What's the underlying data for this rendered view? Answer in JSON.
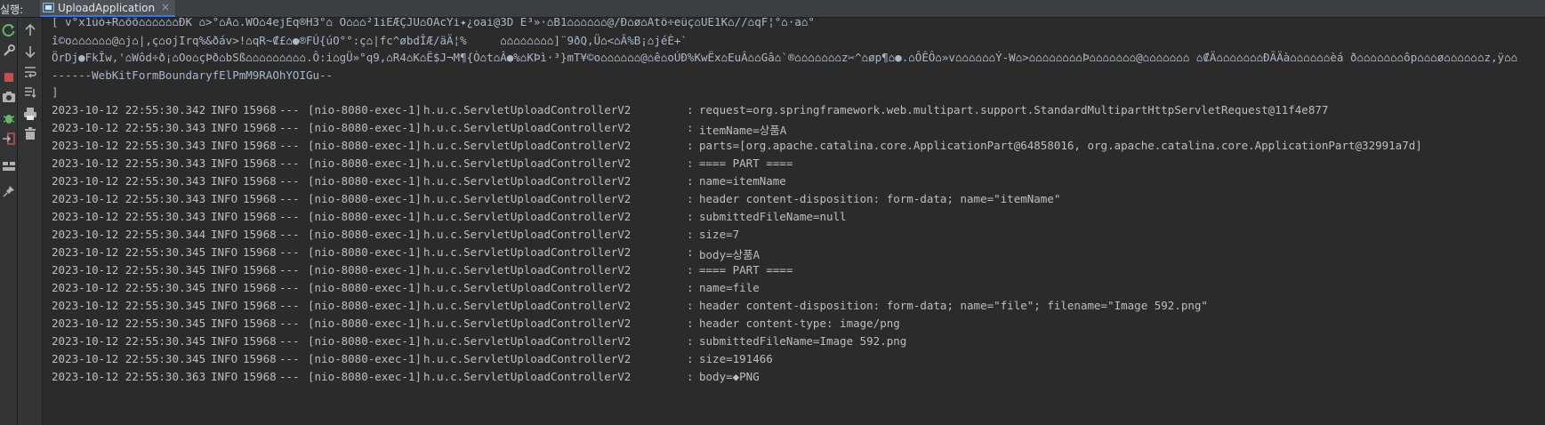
{
  "header": {
    "run_label": "실행:",
    "tab_title": "UploadApplication",
    "tab_close": "×"
  },
  "icons": {
    "left": [
      "rerun-icon",
      "settings-wrench-icon",
      "stop-icon",
      "camera-icon",
      "debug-icon",
      "login-icon",
      "layout-icon",
      "pin-icon"
    ],
    "right": [
      "up-arrow-icon",
      "down-arrow-icon",
      "soft-wrap-icon",
      "scroll-to-end-icon",
      "print-icon",
      "trash-icon"
    ]
  },
  "colors": {
    "accent": "#3574f0",
    "stop": "#c94f4f",
    "rerun": "#5fb865",
    "console_bg": "#2b2b2b",
    "log_text": "#bcbec4"
  },
  "console": {
    "garbled_lines": [
      "[ v°x1ûó+R⌂õõ⌂⌂⌂⌂⌂⌂ÐK ⌂>°⌂A⌂.WO⌂4ejEq®H3°⌂ O⌂⌂⌂²1iEÆÇJÜ⌂OAcYi✦¿oai@3D E³»·⌂B1⌂⌂⌂⌂⌂⌂@/Ð⌂ø⌂Atö÷eüç⌂UE1K⌂//⌂qF¦°⌂·a⌂°",
      "î©o⌂⌂⌂⌂⌂⌂@⌂j⌂|,ç⌂ojIrq%&ðáv>!⌂qR~₡£⌂●®FÚ{úO°°:ç⌂|fc^øbdÎÆ/äÄ¦%     ⌂⌂⌂⌂⌂⌂⌂⌂]¨9ðQ,Ü⌂<⌂Ã%B¡⌂jéÈ+`",
      "ÖrDj●FkÎw,'⌂Wôd÷ð¡⌂Oo⌂çÞð⌂bSß⌂⌂⌂⌂⌂⌂⌂⌂⌂.Ô:i⌂gÜ»°q9,⌂R4⌂K⌂Ë$J¬M¶{Ò⌂t⌂Â●%⌂KÞì·³}mT¥©o⌂⌂⌂⌂⌂⌂@⌂ê⌂oÚÐ%KwËx⌂EuÂ⌂⌂Gâ⌂`®⌂⌂⌂⌂⌂⌂⌂z✂^⌂øp¶⌂●.⌂ÔÊÔ⌂»v⌂⌂⌂⌂⌂⌂Ý-W⌂>⌂⌂⌂⌂⌂⌂⌂⌂Þ⌂⌂⌂⌂⌂⌂⌂@⌂⌂⌂⌂⌂⌂⌂ ⌂₡Ä⌂⌂⌂⌂⌂⌂⌂ÐÃÄà⌂⌂⌂⌂⌂⌂èá ð⌂⌂⌂⌂⌂⌂⌂ôp⌂⌂⌂ø⌂⌂⌂⌂⌂⌂z,ÿ⌂⌂",
      "------WebKitFormBoundaryfElPmM9RAOhYOIGu--",
      "]"
    ],
    "log_lines": [
      {
        "timestamp": "2023-10-12 22:55:30.342",
        "level": "INFO",
        "pid": "15968",
        "sep": "---",
        "thread": "[nio-8080-exec-1]",
        "logger": "h.u.c.ServletUploadControllerV2",
        "colon": ":",
        "message": "request=org.springframework.web.multipart.support.StandardMultipartHttpServletRequest@11f4e877"
      },
      {
        "timestamp": "2023-10-12 22:55:30.343",
        "level": "INFO",
        "pid": "15968",
        "sep": "---",
        "thread": "[nio-8080-exec-1]",
        "logger": "h.u.c.ServletUploadControllerV2",
        "colon": ":",
        "message": "itemName=상품A"
      },
      {
        "timestamp": "2023-10-12 22:55:30.343",
        "level": "INFO",
        "pid": "15968",
        "sep": "---",
        "thread": "[nio-8080-exec-1]",
        "logger": "h.u.c.ServletUploadControllerV2",
        "colon": ":",
        "message": "parts=[org.apache.catalina.core.ApplicationPart@64858016, org.apache.catalina.core.ApplicationPart@32991a7d]"
      },
      {
        "timestamp": "2023-10-12 22:55:30.343",
        "level": "INFO",
        "pid": "15968",
        "sep": "---",
        "thread": "[nio-8080-exec-1]",
        "logger": "h.u.c.ServletUploadControllerV2",
        "colon": ":",
        "message": "==== PART ===="
      },
      {
        "timestamp": "2023-10-12 22:55:30.343",
        "level": "INFO",
        "pid": "15968",
        "sep": "---",
        "thread": "[nio-8080-exec-1]",
        "logger": "h.u.c.ServletUploadControllerV2",
        "colon": ":",
        "message": "name=itemName"
      },
      {
        "timestamp": "2023-10-12 22:55:30.343",
        "level": "INFO",
        "pid": "15968",
        "sep": "---",
        "thread": "[nio-8080-exec-1]",
        "logger": "h.u.c.ServletUploadControllerV2",
        "colon": ":",
        "message": "header content-disposition: form-data; name=\"itemName\""
      },
      {
        "timestamp": "2023-10-12 22:55:30.343",
        "level": "INFO",
        "pid": "15968",
        "sep": "---",
        "thread": "[nio-8080-exec-1]",
        "logger": "h.u.c.ServletUploadControllerV2",
        "colon": ":",
        "message": "submittedFileName=null"
      },
      {
        "timestamp": "2023-10-12 22:55:30.344",
        "level": "INFO",
        "pid": "15968",
        "sep": "---",
        "thread": "[nio-8080-exec-1]",
        "logger": "h.u.c.ServletUploadControllerV2",
        "colon": ":",
        "message": "size=7"
      },
      {
        "timestamp": "2023-10-12 22:55:30.345",
        "level": "INFO",
        "pid": "15968",
        "sep": "---",
        "thread": "[nio-8080-exec-1]",
        "logger": "h.u.c.ServletUploadControllerV2",
        "colon": ":",
        "message": "body=상품A"
      },
      {
        "timestamp": "2023-10-12 22:55:30.345",
        "level": "INFO",
        "pid": "15968",
        "sep": "---",
        "thread": "[nio-8080-exec-1]",
        "logger": "h.u.c.ServletUploadControllerV2",
        "colon": ":",
        "message": "==== PART ===="
      },
      {
        "timestamp": "2023-10-12 22:55:30.345",
        "level": "INFO",
        "pid": "15968",
        "sep": "---",
        "thread": "[nio-8080-exec-1]",
        "logger": "h.u.c.ServletUploadControllerV2",
        "colon": ":",
        "message": "name=file"
      },
      {
        "timestamp": "2023-10-12 22:55:30.345",
        "level": "INFO",
        "pid": "15968",
        "sep": "---",
        "thread": "[nio-8080-exec-1]",
        "logger": "h.u.c.ServletUploadControllerV2",
        "colon": ":",
        "message": "header content-disposition: form-data; name=\"file\"; filename=\"Image 592.png\""
      },
      {
        "timestamp": "2023-10-12 22:55:30.345",
        "level": "INFO",
        "pid": "15968",
        "sep": "---",
        "thread": "[nio-8080-exec-1]",
        "logger": "h.u.c.ServletUploadControllerV2",
        "colon": ":",
        "message": "header content-type: image/png"
      },
      {
        "timestamp": "2023-10-12 22:55:30.345",
        "level": "INFO",
        "pid": "15968",
        "sep": "---",
        "thread": "[nio-8080-exec-1]",
        "logger": "h.u.c.ServletUploadControllerV2",
        "colon": ":",
        "message": "submittedFileName=Image 592.png"
      },
      {
        "timestamp": "2023-10-12 22:55:30.345",
        "level": "INFO",
        "pid": "15968",
        "sep": "---",
        "thread": "[nio-8080-exec-1]",
        "logger": "h.u.c.ServletUploadControllerV2",
        "colon": ":",
        "message": "size=191466"
      },
      {
        "timestamp": "2023-10-12 22:55:30.363",
        "level": "INFO",
        "pid": "15968",
        "sep": "---",
        "thread": "[nio-8080-exec-1]",
        "logger": "h.u.c.ServletUploadControllerV2",
        "colon": ":",
        "message": "body=◆PNG"
      }
    ]
  }
}
